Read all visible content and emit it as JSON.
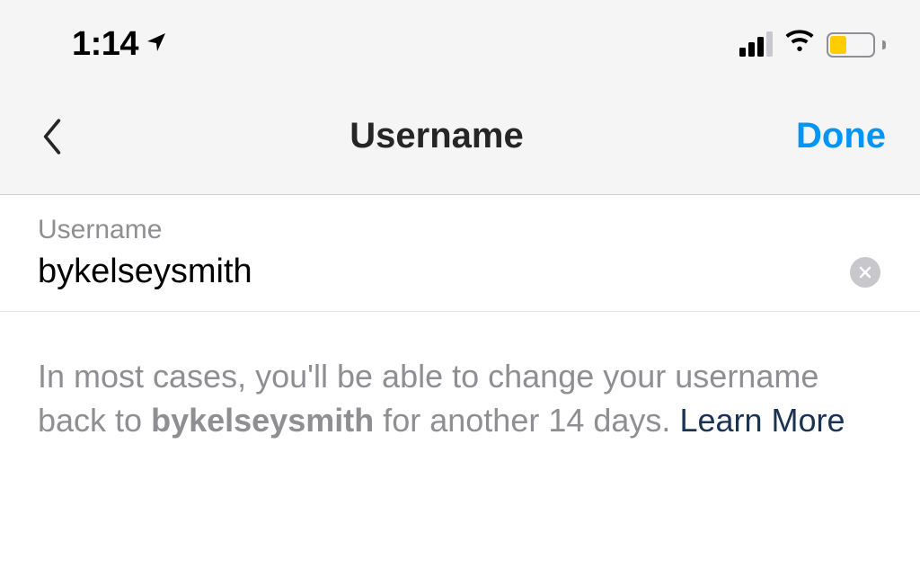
{
  "statusBar": {
    "time": "1:14"
  },
  "navBar": {
    "title": "Username",
    "doneLabel": "Done"
  },
  "input": {
    "label": "Username",
    "value": "bykelseysmith"
  },
  "info": {
    "textBefore": "In most cases, you'll be able to change your username back to ",
    "boldUsername": "bykelseysmith",
    "textAfter": " for another 14 days. ",
    "learnMore": "Learn More"
  }
}
